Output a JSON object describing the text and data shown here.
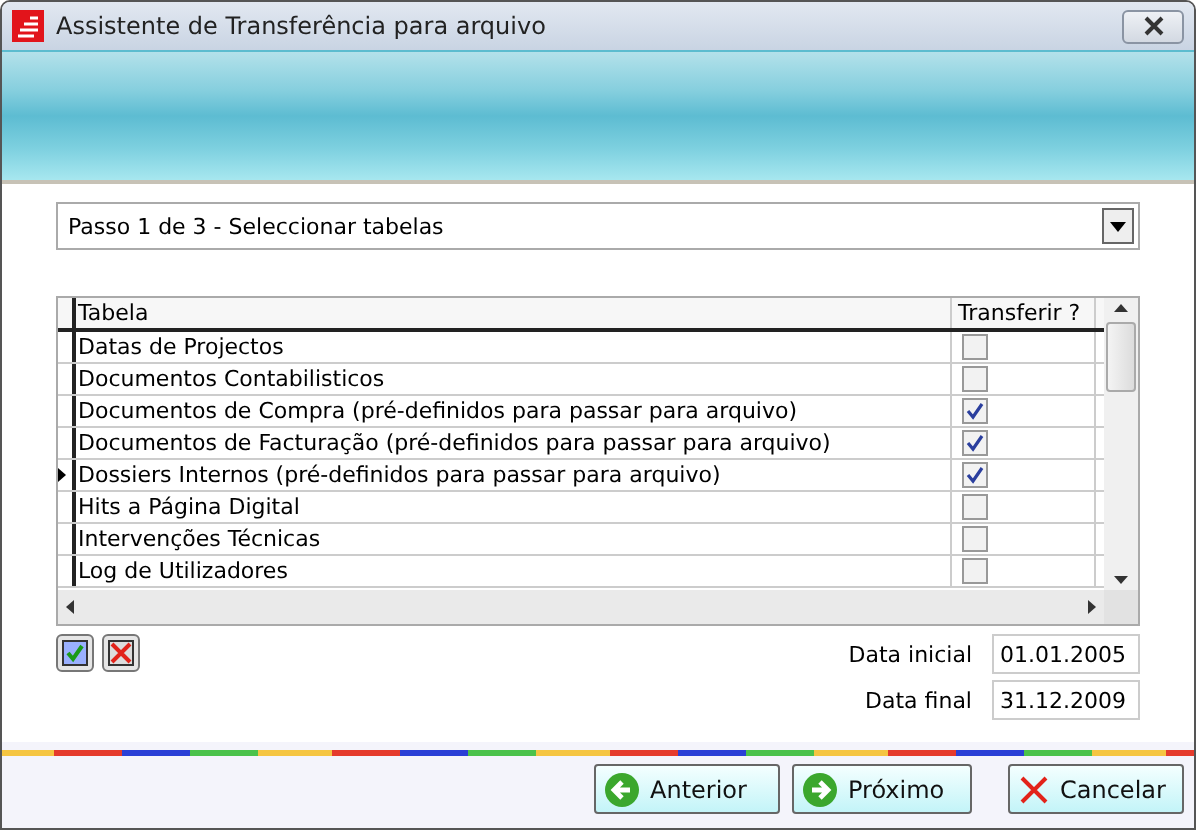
{
  "window": {
    "title": "Assistente de Transferência para arquivo"
  },
  "step": {
    "value": "Passo 1 de 3 - Seleccionar tabelas"
  },
  "table": {
    "columns": [
      "Tabela",
      "Transferir ?"
    ],
    "rows": [
      {
        "name": "Datas de Projectos",
        "checked": false,
        "current": false
      },
      {
        "name": "Documentos Contabilisticos",
        "checked": false,
        "current": false
      },
      {
        "name": "Documentos de Compra (pré-definidos para passar para arquivo)",
        "checked": true,
        "current": false
      },
      {
        "name": "Documentos de Facturação (pré-definidos para passar para arquivo)",
        "checked": true,
        "current": false
      },
      {
        "name": "Dossiers Internos (pré-definidos para passar para arquivo)",
        "checked": true,
        "current": true
      },
      {
        "name": "Hits a Página Digital",
        "checked": false,
        "current": false
      },
      {
        "name": "Intervenções Técnicas",
        "checked": false,
        "current": false
      },
      {
        "name": "Log de Utilizadores",
        "checked": false,
        "current": false
      }
    ]
  },
  "dates": [
    {
      "label": "Data inicial",
      "value": "01.01.2005"
    },
    {
      "label": "Data final",
      "value": "31.12.2009"
    }
  ],
  "buttons": [
    {
      "kind": "back",
      "label": "Anterior"
    },
    {
      "kind": "next",
      "label": "Próximo"
    },
    {
      "kind": "cancel",
      "label": "Cancelar"
    }
  ]
}
